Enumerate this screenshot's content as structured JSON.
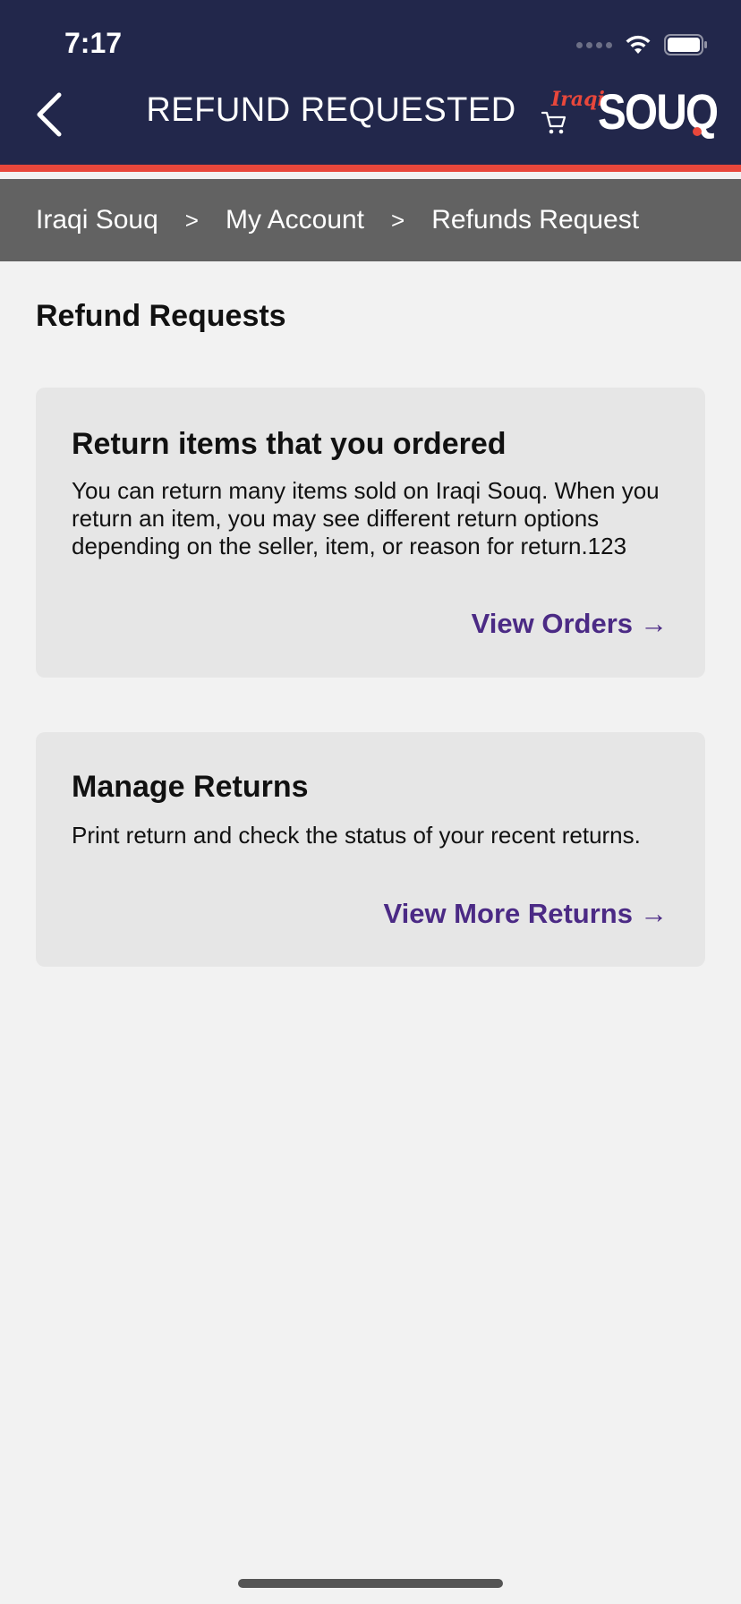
{
  "status_bar": {
    "time": "7:17"
  },
  "header": {
    "title": "REFUND REQUESTED",
    "logo": {
      "iraqi": "Iraqi",
      "souq": "SOUQ"
    },
    "accent_color": "#e8473b",
    "background_color": "#22274b"
  },
  "breadcrumb": {
    "items": [
      "Iraqi Souq",
      "My Account",
      "Refunds Request"
    ],
    "separator": ">"
  },
  "main": {
    "section_title": "Refund Requests",
    "cards": [
      {
        "title": "Return items that you ordered",
        "text": "You can return many items sold on Iraqi Souq. When you return an item, you may see different return options depending on the seller, item, or reason for return.123",
        "link_label": "View Orders",
        "link_arrow": "→"
      },
      {
        "title": "Manage Returns",
        "text": "Print return and check the status of your recent returns.",
        "link_label": "View More Returns",
        "link_arrow": "→"
      }
    ],
    "link_color": "#4b2a85"
  },
  "icons": [
    "back-chevron-icon",
    "cart-icon",
    "wifi-icon",
    "battery-icon",
    "signal-icon",
    "arrow-right-icon"
  ]
}
